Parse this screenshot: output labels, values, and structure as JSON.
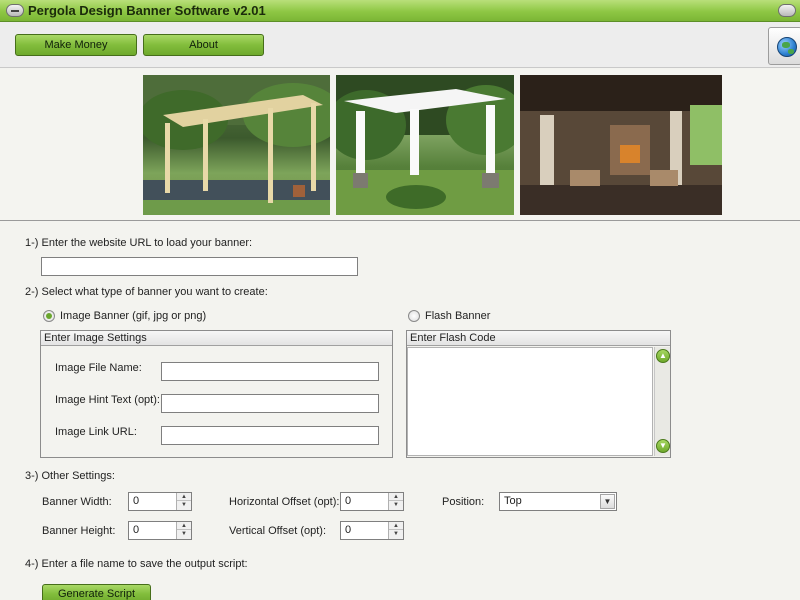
{
  "window": {
    "title": "Pergola Design Banner Software v2.01"
  },
  "toolbar": {
    "make_money_label": "Make Money",
    "about_label": "About",
    "globe_icon": "globe-icon"
  },
  "banner": {
    "images": [
      "pergola-photo-1",
      "pergola-photo-2",
      "pergola-photo-3"
    ]
  },
  "form": {
    "step1_label": "1-) Enter the website URL to load your banner:",
    "url_value": "",
    "step2_label": "2-) Select what type of banner you want to create:",
    "image_banner_label": "Image Banner (gif, jpg or png)",
    "flash_banner_label": "Flash Banner",
    "image_banner_selected": true,
    "image_settings": {
      "title": "Enter Image Settings",
      "file_name_label": "Image File Name:",
      "file_name_value": "",
      "hint_text_label": "Image Hint Text (opt):",
      "hint_text_value": "",
      "link_url_label": "Image Link URL:",
      "link_url_value": ""
    },
    "flash_settings": {
      "title": "Enter Flash Code",
      "code_value": ""
    },
    "step3_label": "3-) Other Settings:",
    "other": {
      "banner_width_label": "Banner Width:",
      "banner_width_value": "0",
      "banner_height_label": "Banner Height:",
      "banner_height_value": "0",
      "h_offset_label": "Horizontal Offset (opt):",
      "h_offset_value": "0",
      "v_offset_label": "Vertical Offset (opt):",
      "v_offset_value": "0",
      "position_label": "Position:",
      "position_value": "Top"
    },
    "step4_label": "4-) Enter a file name to save the output script:",
    "generate_label": "Generate Script"
  },
  "colors": {
    "accent_green": "#82bd3c",
    "titlebar_green": "#8ec744"
  }
}
